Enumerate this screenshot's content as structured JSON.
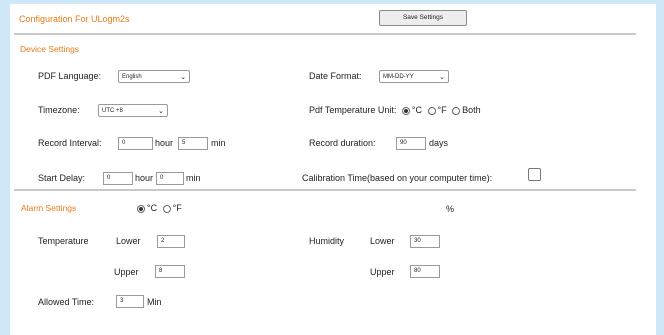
{
  "header": {
    "title": "Configuration For ULogm2s",
    "save_label": "Save Settings"
  },
  "device": {
    "section_label": "Device Settings",
    "pdf_language_label": "PDF Language:",
    "pdf_language_value": "English",
    "date_format_label": "Date Format:",
    "date_format_value": "MM-DD-YY",
    "timezone_label": "Timezone:",
    "timezone_value": "UTC +8",
    "pdf_temp_unit_label": "Pdf Temperature Unit:",
    "pdf_temp_unit_options": [
      "°C",
      "°F",
      "Both"
    ],
    "pdf_temp_unit_selected": "°C",
    "record_interval_label": "Record Interval:",
    "record_interval_hour": "0",
    "record_interval_hour_unit": "hour",
    "record_interval_min": "5",
    "record_interval_min_unit": "min",
    "record_duration_label": "Record duration:",
    "record_duration_value": "90",
    "record_duration_unit": "days",
    "start_delay_label": "Start Delay:",
    "start_delay_hour": "0",
    "start_delay_hour_unit": "hour",
    "start_delay_min": "0",
    "start_delay_min_unit": "min",
    "calibration_label": "Calibration Time(based on your computer time):"
  },
  "alarm": {
    "section_label": "Alarm Settings",
    "unit_options": [
      "°C",
      "°F"
    ],
    "unit_selected": "°C",
    "percent_label": "%",
    "temperature_label": "Temperature",
    "temp_lower_label": "Lower",
    "temp_lower_value": "2",
    "temp_upper_label": "Upper",
    "temp_upper_value": "8",
    "humidity_label": "Humidity",
    "hum_lower_label": "Lower",
    "hum_lower_value": "30",
    "hum_upper_label": "Upper",
    "hum_upper_value": "80",
    "allowed_time_label": "Allowed Time:",
    "allowed_time_value": "3",
    "allowed_time_unit": "Min"
  },
  "colors": {
    "accent": "#e87b1a",
    "background": "#cfe8f8",
    "divider": "#c9c9c9"
  },
  "icons": {
    "dropdown": "chevron-down-icon",
    "radio": "radio-icon"
  }
}
